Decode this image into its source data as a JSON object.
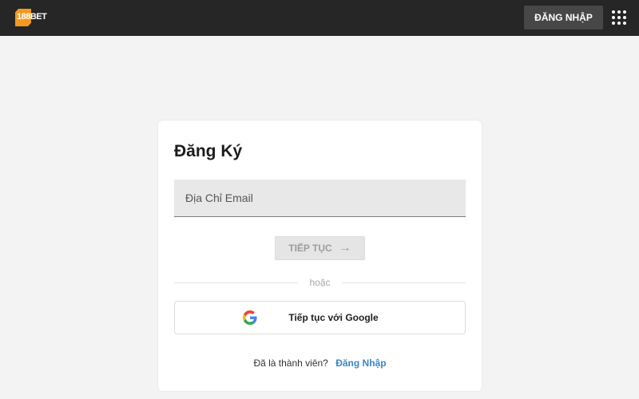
{
  "header": {
    "logo_text": "188BET",
    "login_label": "ĐĂNG NHẬP",
    "menu_icon": "grid-menu-icon"
  },
  "register": {
    "title": "Đăng Ký",
    "email_placeholder": "Địa Chỉ Email",
    "continue_label": "TIẾP TỤC",
    "divider_text": "hoặc",
    "google_label": "Tiếp tục với Google",
    "member_prompt": "Đã là thành viên?",
    "login_link": "Đăng Nhập"
  },
  "colors": {
    "topbar": "#262626",
    "brand_orange": "#f39a1e",
    "link_blue": "#3a86c4"
  }
}
